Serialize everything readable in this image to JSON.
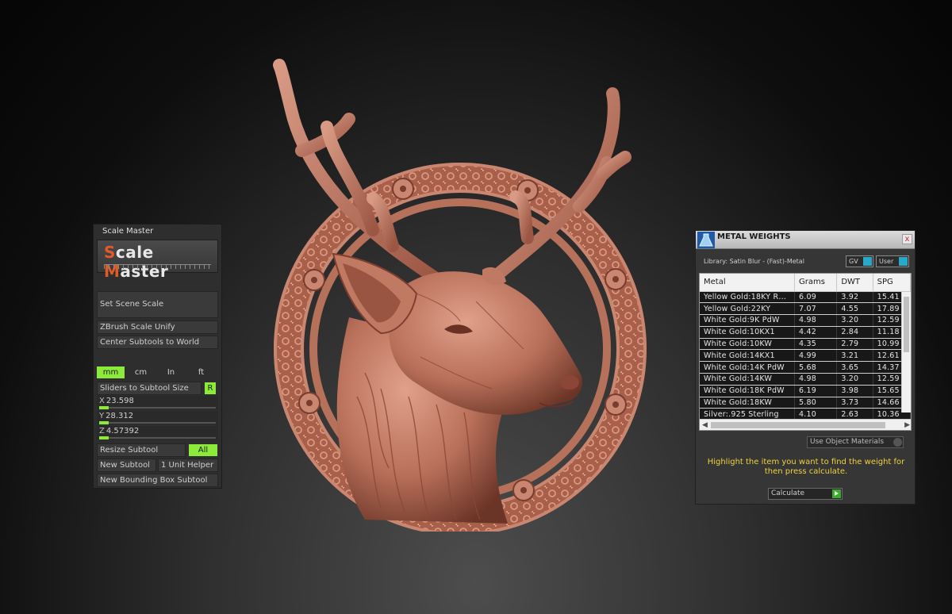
{
  "scale_master": {
    "title": "Scale Master",
    "logo": {
      "first_letter": "S",
      "first_rest": "cale ",
      "second_letter": "M",
      "second_rest": "aster"
    },
    "buttons": {
      "set_scene_scale": "Set Scene Scale",
      "zbrush_scale_unify": "ZBrush Scale Unify",
      "center_subtools": "Center Subtools to World",
      "sliders_to_subtool_size": "Sliders to Subtool Size",
      "resize_subtool": "Resize Subtool",
      "new_subtool": "New Subtool",
      "one_unit_helper": "1 Unit Helper",
      "new_bounding_box": "New Bounding Box Subtool"
    },
    "units": [
      "mm",
      "cm",
      "In",
      "ft"
    ],
    "active_unit": "mm",
    "r_tag": "R",
    "all_tag": "All",
    "sliders": [
      {
        "axis": "X",
        "value": "23.598"
      },
      {
        "axis": "Y",
        "value": "28.312"
      },
      {
        "axis": "Z",
        "value": "4.57392"
      }
    ]
  },
  "metal_weights": {
    "title": "METAL WEIGHTS",
    "close": "x",
    "library": "Library: Satin Blur - (Fast)-Metal",
    "toggles": {
      "gv": "GV",
      "user": "User"
    },
    "columns": [
      "Metal",
      "Grams",
      "DWT",
      "SPG"
    ],
    "rows": [
      [
        "Yellow Gold:18KY R…",
        "6.09",
        "3.92",
        "15.41"
      ],
      [
        "Yellow Gold:22KY",
        "7.07",
        "4.55",
        "17.89"
      ],
      [
        "White Gold:9K PdW",
        "4.98",
        "3.20",
        "12.59"
      ],
      [
        "White Gold:10KX1",
        "4.42",
        "2.84",
        "11.18"
      ],
      [
        "White Gold:10KW",
        "4.35",
        "2.79",
        "10.99"
      ],
      [
        "White Gold:14KX1",
        "4.99",
        "3.21",
        "12.61"
      ],
      [
        "White Gold:14K PdW",
        "5.68",
        "3.65",
        "14.37"
      ],
      [
        "White Gold:14KW",
        "4.98",
        "3.20",
        "12.59"
      ],
      [
        "White Gold:18K PdW",
        "6.19",
        "3.98",
        "15.65"
      ],
      [
        "White Gold:18KW",
        "5.80",
        "3.73",
        "14.66"
      ],
      [
        "Silver:.925 Sterling",
        "4.10",
        "2.63",
        "10.36"
      ]
    ],
    "use_object_materials": "Use Object Materials",
    "hint": "Highlight the item you want to find the weight for then press calculate.",
    "calculate": "Calculate"
  },
  "colors": {
    "accent_green": "#8bea3a",
    "hint_yellow": "#f0d23c",
    "logo_orange": "#e05a2a",
    "medallion": "#c9826c"
  }
}
